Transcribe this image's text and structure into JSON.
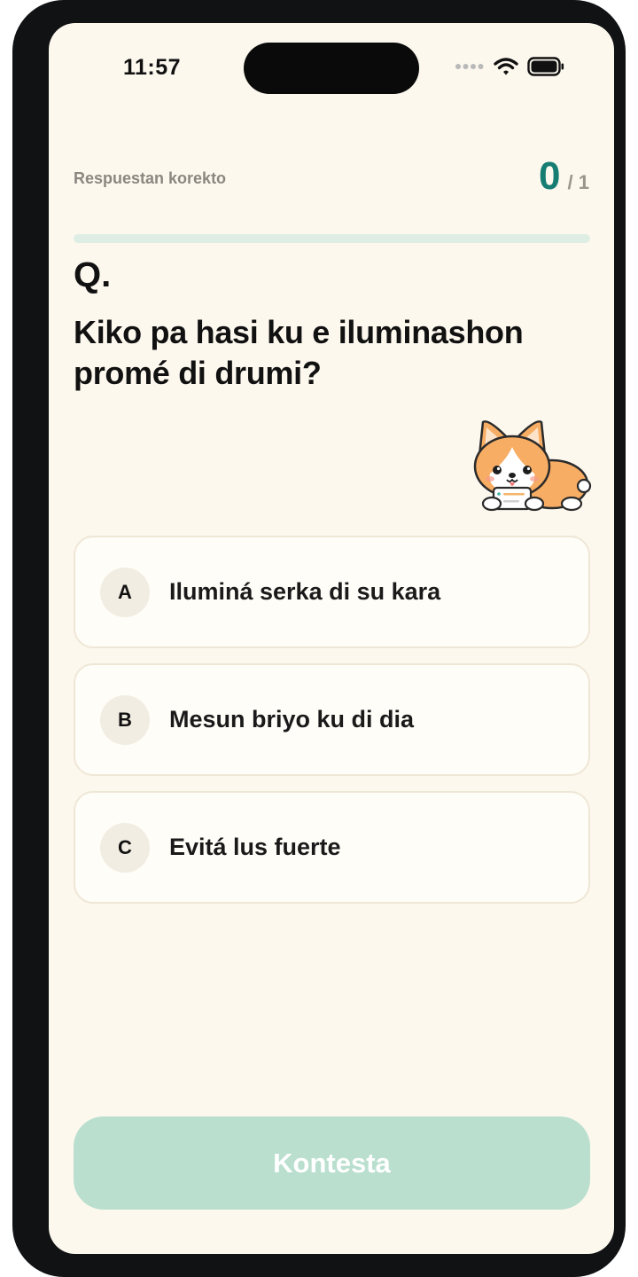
{
  "status_bar": {
    "time": "11:57",
    "icons": [
      "signal-dots-icon",
      "wifi-icon",
      "battery-icon"
    ]
  },
  "score": {
    "label": "Respuestan korekto",
    "value": "0",
    "total": "/ 1",
    "progress": 0
  },
  "question": {
    "marker": "Q.",
    "text": "Kiko pa hasi ku e iluminashon promé di drumi?"
  },
  "mascot": {
    "icon": "corgi-mascot-icon"
  },
  "options": [
    {
      "letter": "A",
      "text": "Iluminá serka di su kara"
    },
    {
      "letter": "B",
      "text": "Mesun briyo ku di dia"
    },
    {
      "letter": "C",
      "text": "Evitá lus fuerte"
    }
  ],
  "submit": {
    "label": "Kontesta"
  },
  "colors": {
    "background": "#fcf8ee",
    "accent": "#167d72",
    "button_disabled": "#badfce",
    "progress_track": "#dfeee4"
  }
}
